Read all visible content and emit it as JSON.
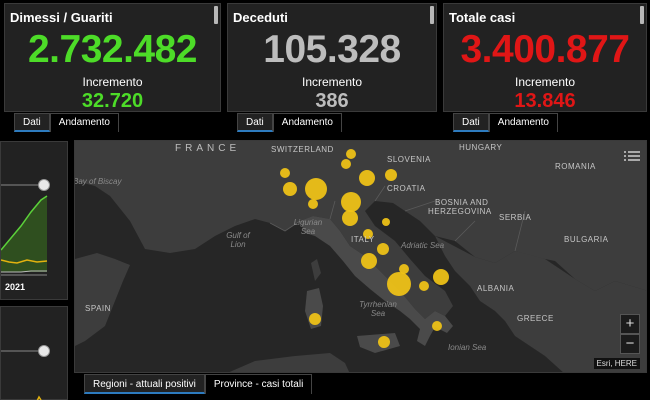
{
  "cards": {
    "recovered": {
      "title": "Dimessi / Guariti",
      "value": "2.732.482",
      "increment_label": "Incremento",
      "increment": "32.720",
      "color": "#4ddc28"
    },
    "deaths": {
      "title": "Deceduti",
      "value": "105.328",
      "increment_label": "Incremento",
      "increment": "386",
      "color": "#bdbdbd"
    },
    "total": {
      "title": "Totale casi",
      "value": "3.400.877",
      "increment_label": "Incremento",
      "increment": "13.846",
      "color": "#e01616"
    }
  },
  "card_tabs": {
    "data": "Dati",
    "trend": "Andamento"
  },
  "side_chart": {
    "year": "2021"
  },
  "map": {
    "labels": {
      "france": "FRANCE",
      "switzerland": "SWITZERLAND",
      "slovenia": "SLOVENIA",
      "hungary": "HUNGARY",
      "romania": "ROMANIA",
      "croatia": "CROATIA",
      "bosnia1": "BOSNIA AND",
      "bosnia2": "HERZEGOVINA",
      "serbia": "SERBIA",
      "bulgaria": "BULGARIA",
      "italy": "ITALY",
      "albania": "ALBANIA",
      "greece": "GREECE",
      "spain": "SPAIN",
      "biscay": "Bay of Biscay",
      "gulf_lion": "Gulf of Lion",
      "ligurian": "Ligurian Sea",
      "adriatic": "Adriatic Sea",
      "tyrrhenian": "Tyrrhenian Sea",
      "ionian": "Ionian Sea"
    },
    "zoom_in": "+",
    "zoom_out": "−",
    "attribution": "Esri, HERE",
    "bubble_color": "#f2c416"
  },
  "bottom_tabs": {
    "regions": "Regioni - attuali positivi",
    "provinces": "Province - casi totali"
  }
}
